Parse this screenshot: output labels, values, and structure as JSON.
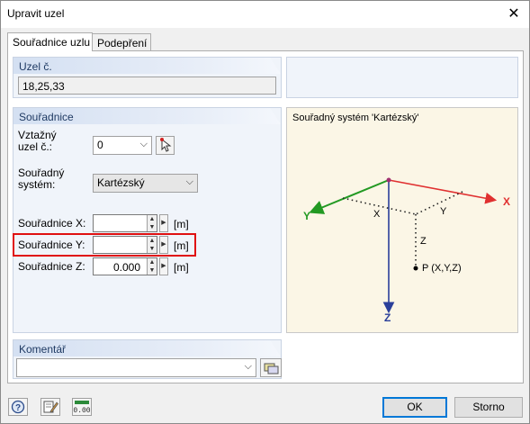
{
  "window": {
    "title": "Upravit uzel"
  },
  "tabs": [
    {
      "label": "Souřadnice uzlu",
      "active": true
    },
    {
      "label": "Podepření",
      "active": false
    }
  ],
  "node_group": {
    "header": "Uzel č.",
    "value": "18,25,33"
  },
  "coords_group": {
    "header": "Souřadnice",
    "reference_node_label_line1": "Vztažný",
    "reference_node_label_line2": "uzel č.:",
    "reference_node_value": "0",
    "coord_system_label_line1": "Souřadný",
    "coord_system_label_line2": "systém:",
    "coord_system_value": "Kartézský",
    "x_label": "Souřadnice X:",
    "x_value": "",
    "x_unit": "[m]",
    "y_label": "Souřadnice Y:",
    "y_value": "",
    "y_unit": "[m]",
    "z_label": "Souřadnice Z:",
    "z_value": "0.000",
    "z_unit": "[m]"
  },
  "diagram": {
    "title": "Souřadný systém 'Kartézský'",
    "axis_x": "X",
    "axis_y": "Y",
    "axis_z": "Z",
    "proj_x": "X",
    "proj_y": "Y",
    "proj_z": "Z",
    "point_label": "P (X,Y,Z)",
    "colors": {
      "x": "#e03030",
      "y": "#229922",
      "z": "#2a3f9a",
      "origin": "#a03070"
    }
  },
  "comment_group": {
    "header": "Komentář",
    "value": ""
  },
  "buttons": {
    "ok": "OK",
    "cancel": "Storno"
  },
  "footer_icons": [
    "help-icon",
    "edit-icon",
    "units-icon"
  ],
  "footer_units_text": "0.00"
}
